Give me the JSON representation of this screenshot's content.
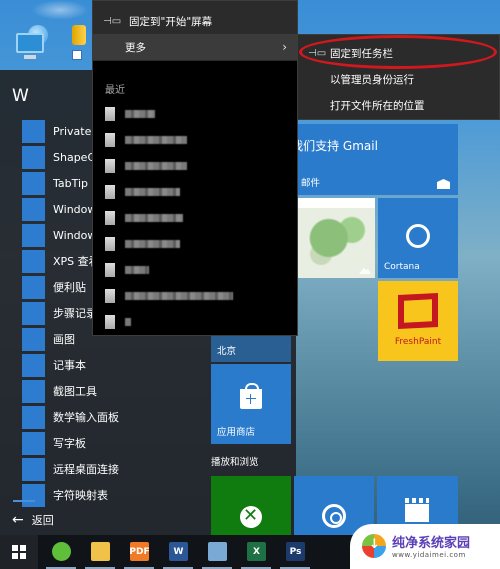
{
  "context_menu": {
    "pin_to_start": "固定到\"开始\"屏幕",
    "more": "更多",
    "recent_title": "最近",
    "recent_items_count": 9
  },
  "submenu": {
    "items": [
      {
        "label": "固定到任务栏",
        "icon": "pin-icon",
        "highlighted": true
      },
      {
        "label": "以管理员身份运行"
      },
      {
        "label": "打开文件所在的位置"
      }
    ]
  },
  "start_menu": {
    "section_letter": "W",
    "apps": [
      {
        "label": "Private C",
        "icon": "private-character-editor-icon"
      },
      {
        "label": "ShapeCo",
        "icon": "shape-collector-icon"
      },
      {
        "label": "TabTip",
        "icon": "keyboard-icon"
      },
      {
        "label": "Windows",
        "icon": "windows-fax-icon"
      },
      {
        "label": "Windows",
        "icon": "windows-journal-icon"
      },
      {
        "label": "XPS 查看器",
        "icon": "xps-viewer-icon"
      },
      {
        "label": "便利贴",
        "icon": "sticky-notes-icon"
      },
      {
        "label": "步骤记录器",
        "icon": "steps-recorder-icon"
      },
      {
        "label": "画图",
        "icon": "paint-icon"
      },
      {
        "label": "记事本",
        "icon": "notepad-icon"
      },
      {
        "label": "截图工具",
        "icon": "snipping-tool-icon"
      },
      {
        "label": "数学输入面板",
        "icon": "math-input-icon"
      },
      {
        "label": "写字板",
        "icon": "wordpad-icon"
      },
      {
        "label": "远程桌面连接",
        "icon": "remote-desktop-icon"
      },
      {
        "label": "字符映射表",
        "icon": "character-map-icon"
      }
    ],
    "back_label": "返回"
  },
  "tiles": {
    "mail_headline": "我们支持 Gmail",
    "mail_label": "邮件",
    "cortana_label": "Cortana",
    "freshpaint_label": "FreshPaint",
    "beijing_label": "北京",
    "store_label": "应用商店",
    "section_play": "播放和浏览"
  },
  "taskbar": {
    "apps": [
      {
        "name": "360-browser",
        "glyph": "",
        "color": "#5fbf3a"
      },
      {
        "name": "file-explorer",
        "glyph": "",
        "color": "#f0c24a"
      },
      {
        "name": "pdf-reader",
        "glyph": "PDF",
        "color": "#f07a26"
      },
      {
        "name": "word",
        "glyph": "W",
        "color": "#2b5797"
      },
      {
        "name": "control-panel",
        "glyph": "",
        "color": "#7aa9d6"
      },
      {
        "name": "excel",
        "glyph": "X",
        "color": "#1e7145"
      },
      {
        "name": "photoshop",
        "glyph": "Ps",
        "color": "#1c3a6b"
      }
    ]
  },
  "watermark": {
    "title": "纯净系统家园",
    "url": "www.yidaimei.com"
  }
}
